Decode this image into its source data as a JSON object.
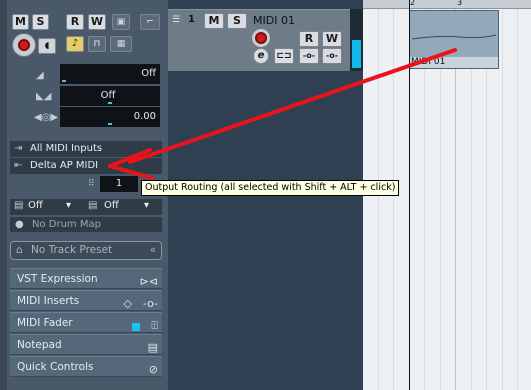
{
  "inspector": {
    "buttons": {
      "mute": "M",
      "solo": "S",
      "read": "R",
      "write": "W"
    },
    "volume": {
      "value": "Off",
      "level": 0
    },
    "pan": {
      "value": "Off",
      "level": 0.5
    },
    "delay": {
      "value": "0.00",
      "level": 0.5
    },
    "input_routing": "All MIDI Inputs",
    "output_routing": "Delta AP MIDI",
    "channel": "1",
    "program": "Off",
    "bank": "Off",
    "drum_map": "No Drum Map",
    "track_preset": "No Track Preset",
    "sections": [
      "VST Expression",
      "MIDI Inserts",
      "MIDI Fader",
      "Notepad",
      "Quick Controls"
    ]
  },
  "track": {
    "number": "1",
    "name": "MIDI 01",
    "buttons": {
      "mute": "M",
      "solo": "S",
      "read": "R",
      "write": "W",
      "edit": "e"
    }
  },
  "arranger": {
    "ruler_marks": [
      "2",
      "3"
    ],
    "part_name": "MIDI 01"
  },
  "tooltip": "Output Routing (all selected with Shift + ALT + click)",
  "colors": {
    "arrow": "#e8141b",
    "record": "#d11b1b",
    "meter": "#13b9ea"
  }
}
